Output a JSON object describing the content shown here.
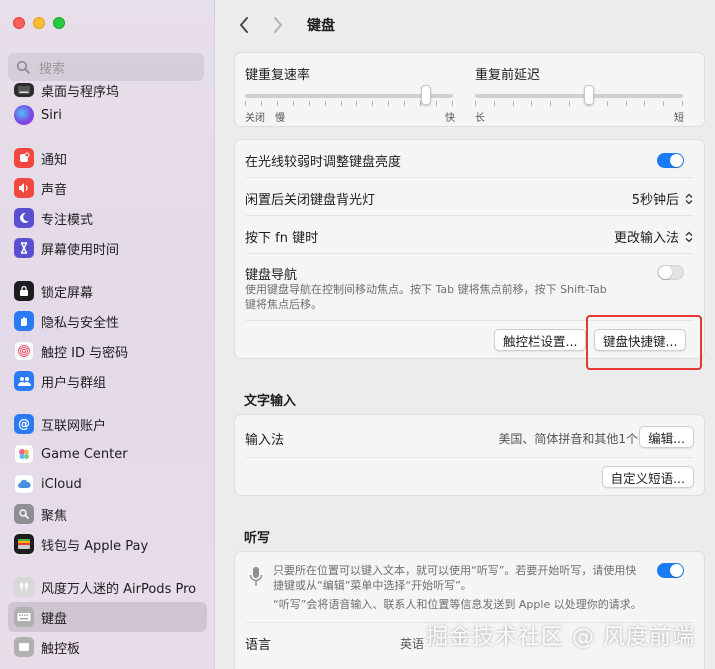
{
  "window": {
    "search_placeholder": "搜索",
    "page_title": "键盘"
  },
  "sidebar": {
    "items": [
      {
        "label": "桌面与程序坞",
        "icon": "dock-icon",
        "color": "#2b2b2b"
      },
      {
        "label": "Siri",
        "icon": "siri-icon",
        "color": "#7b3fe4"
      },
      {
        "label": "通知",
        "icon": "notifications-icon",
        "color": "#f2473f"
      },
      {
        "label": "声音",
        "icon": "sound-icon",
        "color": "#f2473f"
      },
      {
        "label": "专注模式",
        "icon": "focus-moon-icon",
        "color": "#5a4fcf"
      },
      {
        "label": "屏幕使用时间",
        "icon": "screen-time-icon",
        "color": "#5a4fcf"
      },
      {
        "label": "锁定屏幕",
        "icon": "lock-screen-icon",
        "color": "#1d1d1f"
      },
      {
        "label": "隐私与安全性",
        "icon": "privacy-hand-icon",
        "color": "#2b7bf6"
      },
      {
        "label": "触控 ID 与密码",
        "icon": "touch-id-icon",
        "color": "#f2f2f2"
      },
      {
        "label": "用户与群组",
        "icon": "users-icon",
        "color": "#2b7bf6"
      },
      {
        "label": "互联网账户",
        "icon": "internet-accounts-icon",
        "color": "#2b7bf6"
      },
      {
        "label": "Game Center",
        "icon": "game-center-icon",
        "color": "#ffffff"
      },
      {
        "label": "iCloud",
        "icon": "icloud-icon",
        "color": "#ffffff"
      },
      {
        "label": "聚焦",
        "icon": "spotlight-icon",
        "color": "#8e8e93"
      },
      {
        "label": "钱包与 Apple Pay",
        "icon": "wallet-icon",
        "color": "#1d1d1f"
      },
      {
        "label": "风度万人迷的 AirPods Pro",
        "icon": "airpods-icon",
        "color": "#bdbdbd"
      },
      {
        "label": "键盘",
        "icon": "keyboard-icon",
        "color": "#a8a8a8"
      },
      {
        "label": "触控板",
        "icon": "trackpad-icon",
        "color": "#a8a8a8"
      }
    ]
  },
  "keyboard": {
    "repeat_rate": {
      "label": "键重复速率",
      "left": "关闭",
      "left2": "慢",
      "right": "快",
      "value": 0.87
    },
    "delay": {
      "label": "重复前延迟",
      "left": "长",
      "right": "短",
      "value": 0.55
    },
    "brightness_label": "在光线较弱时调整键盘亮度",
    "brightness_on": true,
    "backlight_label": "闲置后关闭键盘背光灯",
    "backlight_value": "5秒钟后",
    "fn_label": "按下 fn 键时",
    "fn_value": "更改输入法",
    "nav_label": "键盘导航",
    "nav_desc": "使用键盘导航在控制间移动焦点。按下 Tab 键将焦点前移，按下 Shift-Tab 键将焦点后移。",
    "nav_on": false,
    "touchbar_button": "触控栏设置...",
    "shortcuts_button": "键盘快捷键..."
  },
  "text_input": {
    "section_title": "文字输入",
    "input_label": "输入法",
    "input_value": "美国、简体拼音和其他1个",
    "edit_button": "编辑...",
    "replace_button": "自定义短语..."
  },
  "dictation": {
    "section_title": "听写",
    "desc1": "只要所在位置可以键入文本，就可以使用“听写”。若要开始听写，请使用快捷键或从“编辑”菜单中选择“开始听写”。",
    "desc2": "“听写”会将语音输入、联系人和位置等信息发送到 Apple 以处理你的请求。",
    "on": true,
    "language_label": "语言",
    "language_value": "英语"
  },
  "watermark": "掘金技术社区 @ 风度前端"
}
